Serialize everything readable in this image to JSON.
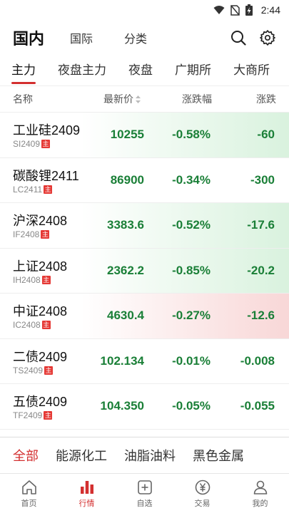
{
  "status_bar": {
    "time": "2:44"
  },
  "top_nav": {
    "tabs": [
      {
        "label": "国内",
        "active": true
      },
      {
        "label": "国际",
        "active": false
      },
      {
        "label": "分类",
        "active": false
      }
    ]
  },
  "sub_nav": {
    "tabs": [
      {
        "label": "主力",
        "active": true
      },
      {
        "label": "夜盘主力",
        "active": false
      },
      {
        "label": "夜盘",
        "active": false
      },
      {
        "label": "广期所",
        "active": false
      },
      {
        "label": "大商所",
        "active": false
      }
    ]
  },
  "table": {
    "headers": {
      "name": "名称",
      "price": "最新价",
      "pct": "涨跌幅",
      "chg": "涨跌"
    },
    "badge": "主",
    "rows": [
      {
        "name": "工业硅2409",
        "code": "SI2409",
        "price": "10255",
        "pct": "-0.58%",
        "chg": "-60",
        "highlight": "green"
      },
      {
        "name": "碳酸锂2411",
        "code": "LC2411",
        "price": "86900",
        "pct": "-0.34%",
        "chg": "-300",
        "highlight": "none"
      },
      {
        "name": "沪深2408",
        "code": "IF2408",
        "price": "3383.6",
        "pct": "-0.52%",
        "chg": "-17.6",
        "highlight": "green"
      },
      {
        "name": "上证2408",
        "code": "IH2408",
        "price": "2362.2",
        "pct": "-0.85%",
        "chg": "-20.2",
        "highlight": "green"
      },
      {
        "name": "中证2408",
        "code": "IC2408",
        "price": "4630.4",
        "pct": "-0.27%",
        "chg": "-12.6",
        "highlight": "red"
      },
      {
        "name": "二债2409",
        "code": "TS2409",
        "price": "102.134",
        "pct": "-0.01%",
        "chg": "-0.008",
        "highlight": "none"
      },
      {
        "name": "五债2409",
        "code": "TF2409",
        "price": "104.350",
        "pct": "-0.05%",
        "chg": "-0.055",
        "highlight": "none"
      }
    ]
  },
  "categories": [
    {
      "label": "全部",
      "active": true
    },
    {
      "label": "能源化工",
      "active": false
    },
    {
      "label": "油脂油料",
      "active": false
    },
    {
      "label": "黑色金属",
      "active": false
    }
  ],
  "bottom_nav": [
    {
      "label": "首页",
      "icon": "home-icon",
      "active": false
    },
    {
      "label": "行情",
      "icon": "chart-bars-icon",
      "active": true
    },
    {
      "label": "自选",
      "icon": "add-box-icon",
      "active": false
    },
    {
      "label": "交易",
      "icon": "yen-icon",
      "active": false
    },
    {
      "label": "我的",
      "icon": "user-icon",
      "active": false
    }
  ],
  "colors": {
    "accent": "#d32f2f",
    "down_green": "#1a7f37",
    "green_tint": "#d9f2de",
    "red_tint": "#f8d7d7"
  }
}
